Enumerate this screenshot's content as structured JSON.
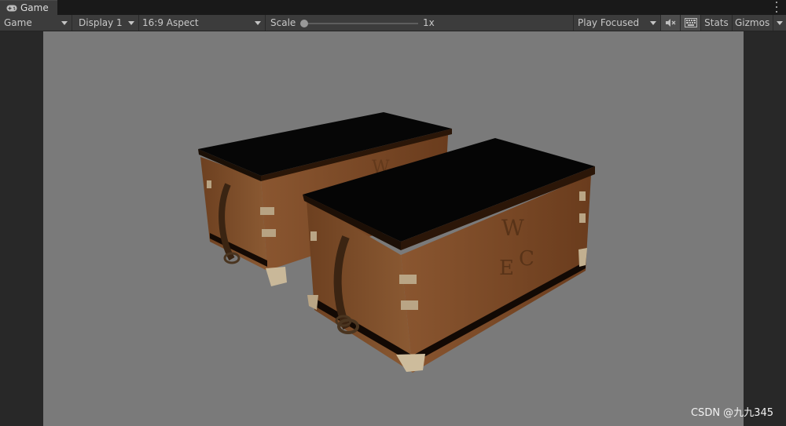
{
  "tab": {
    "label": "Game",
    "icon": "gamepad-icon"
  },
  "toolbar": {
    "view_mode": "Game",
    "display": "Display 1",
    "aspect": "16:9 Aspect",
    "scale_label": "Scale",
    "scale_value": "1x",
    "scale_slider_position": 0.0,
    "play_mode": "Play Focused",
    "mute_icon": "speaker-mute-icon",
    "keyboard_icon": "keyboard-icon",
    "stats_label": "Stats",
    "gizmos_label": "Gizmos"
  },
  "viewport": {
    "background": "#7a7a7a",
    "chest_wood": "#7a4a26",
    "chest_lid": "#060606",
    "chest_markings": [
      "W",
      "E",
      "C"
    ]
  },
  "watermark": "CSDN @九九345"
}
